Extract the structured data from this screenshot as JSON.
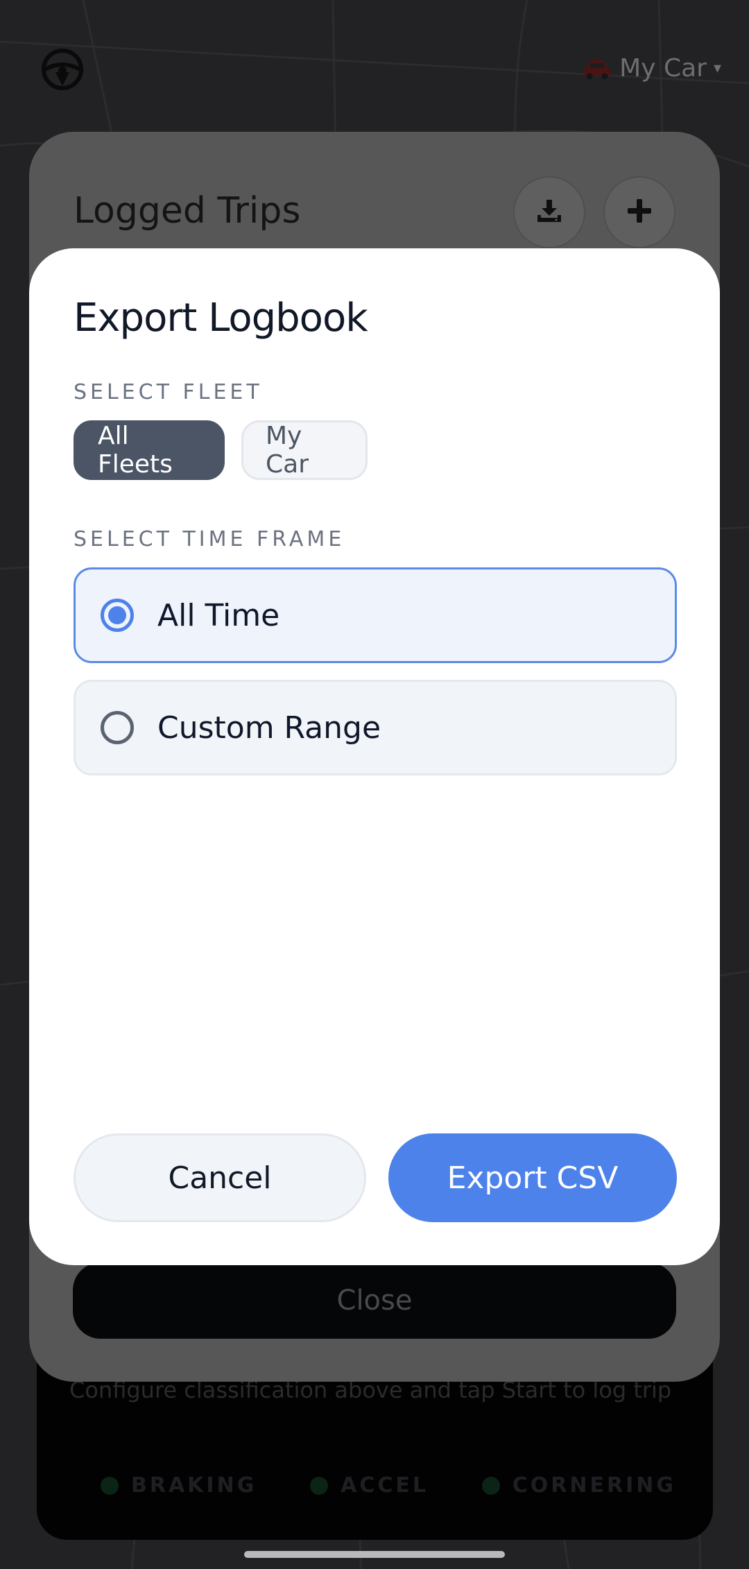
{
  "top_bar": {
    "car_selector_label": "My Car",
    "car_selector_caret": "▾"
  },
  "hud": {
    "hint": "Configure classification above and tap Start to log trip",
    "indicators": [
      {
        "label": "BRAKING"
      },
      {
        "label": "ACCEL"
      },
      {
        "label": "CORNERING"
      }
    ]
  },
  "trips_sheet": {
    "title": "Logged Trips",
    "close_label": "Close"
  },
  "export_modal": {
    "title": "Export Logbook",
    "fleet_label": "SELECT FLEET",
    "fleet_options": [
      {
        "label": "All Fleets",
        "selected": true
      },
      {
        "label": "My Car",
        "selected": false
      }
    ],
    "time_label": "SELECT TIME FRAME",
    "time_options": [
      {
        "label": "All Time",
        "selected": true
      },
      {
        "label": "Custom Range",
        "selected": false
      }
    ],
    "cancel_label": "Cancel",
    "export_label": "Export CSV"
  },
  "icons": {
    "steering": "steering-wheel-icon",
    "car": "car-icon",
    "download": "download-icon",
    "add": "plus-icon"
  },
  "colors": {
    "accent": "#4d82ea",
    "chip_active": "#4b5565"
  }
}
